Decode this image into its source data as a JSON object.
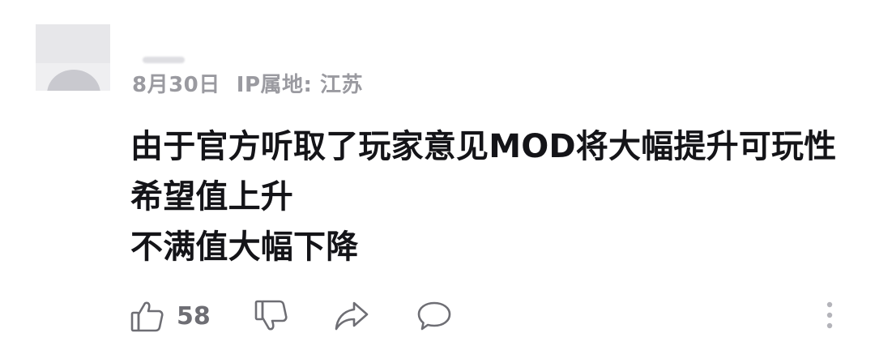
{
  "comment": {
    "date": "8月30日",
    "ip_location": "IP属地: 江苏",
    "lines": [
      "由于官方听取了玩家意见MOD将大幅提升可玩性",
      "希望值上升",
      "不满值大幅下降"
    ],
    "like_count": "58"
  },
  "icons": {
    "like": "thumbs-up-icon",
    "dislike": "thumbs-down-icon",
    "share": "share-arrow-icon",
    "reply": "speech-bubble-icon",
    "more": "more-vertical-icon"
  },
  "colors": {
    "text_primary": "#141418",
    "text_secondary": "#9a9aa0",
    "icon": "#6e6e74"
  }
}
